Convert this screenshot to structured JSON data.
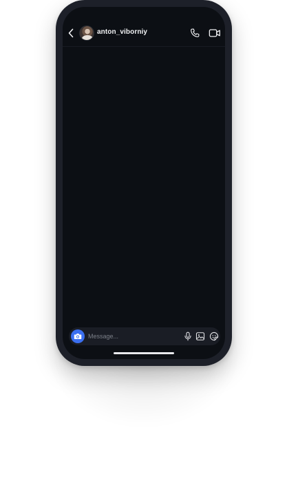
{
  "chat": {
    "username": "anton_viborniy"
  },
  "composer": {
    "placeholder": "Message..."
  },
  "icons": {
    "back": "chevron-left-icon",
    "avatar": "profile-photo",
    "call": "phone-icon",
    "video": "video-camera-icon",
    "camera": "camera-icon",
    "mic": "microphone-icon",
    "gallery": "image-icon",
    "sticker": "sticker-icon"
  },
  "colors": {
    "screen_background": "#0c0f14",
    "phone_frame": "#1d2029",
    "accent": "#3b6ff0",
    "composer_background": "#1a1d25",
    "text": "#f2f3f5",
    "placeholder": "#7c8089"
  }
}
